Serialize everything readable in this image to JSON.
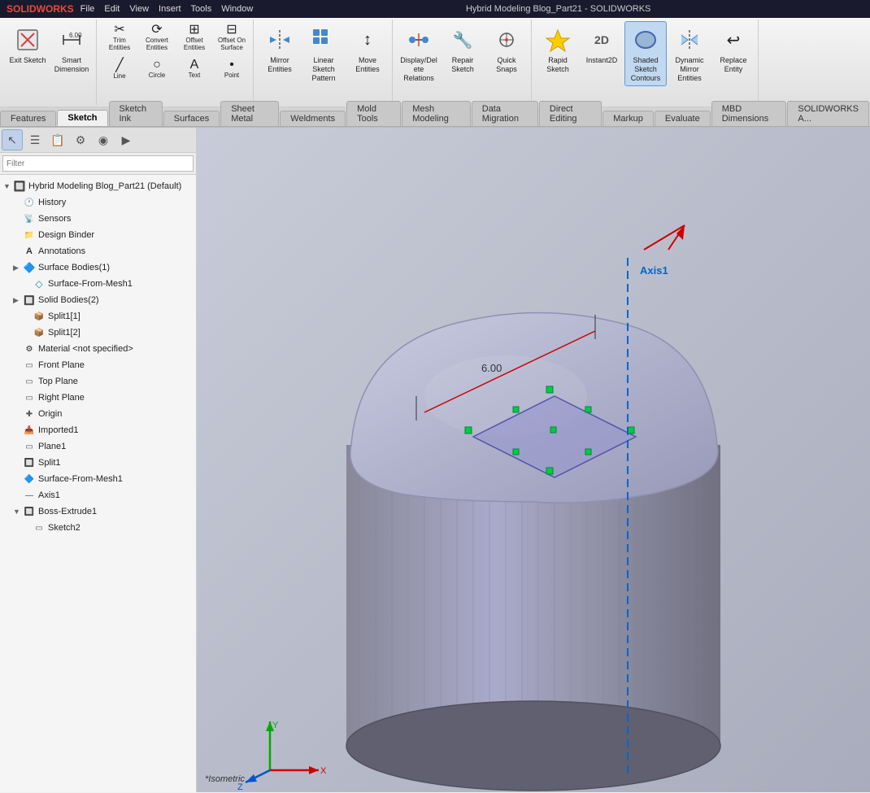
{
  "app": {
    "logo": "SOLIDWORKS",
    "title": "Hybrid Modeling Blog_Part21 - SOLIDWORKS"
  },
  "menubar": {
    "items": [
      "File",
      "Edit",
      "View",
      "Insert",
      "Tools",
      "Window"
    ]
  },
  "toolbar": {
    "groups": [
      {
        "name": "sketch-exit",
        "buttons": [
          {
            "id": "exit-sketch",
            "icon": "📐",
            "label": "Exit\nSketch",
            "active": false
          },
          {
            "id": "smart-dimension",
            "icon": "↔",
            "label": "Smart\nDimension",
            "active": false
          }
        ]
      },
      {
        "name": "trim-convert",
        "buttons": [
          {
            "id": "trim-entities",
            "icon": "✂",
            "label": "Trim\nEntities",
            "active": false
          },
          {
            "id": "convert-entities",
            "icon": "⟳",
            "label": "Convert\nEntities",
            "active": false
          },
          {
            "id": "offset-entities",
            "icon": "⊞",
            "label": "Offset\nEntities",
            "active": false
          },
          {
            "id": "offset-on-surface",
            "icon": "⊟",
            "label": "Offset\nOn\nSurface",
            "active": false
          }
        ]
      },
      {
        "name": "mirror-move",
        "buttons": [
          {
            "id": "mirror-entities",
            "icon": "⟺",
            "label": "Mirror Entities",
            "active": false
          },
          {
            "id": "linear-sketch-pattern",
            "icon": "⊞",
            "label": "Linear Sketch\nPattern",
            "active": false
          },
          {
            "id": "move-entities",
            "icon": "↕",
            "label": "Move Entities",
            "active": false
          }
        ]
      },
      {
        "name": "display-repair",
        "buttons": [
          {
            "id": "display-delete-relations",
            "icon": "🔗",
            "label": "Display/Delete\nRelations",
            "active": false
          },
          {
            "id": "repair-sketch",
            "icon": "🔧",
            "label": "Repair\nSketch",
            "active": false
          },
          {
            "id": "quick-snaps",
            "icon": "🎯",
            "label": "Quick\nSnaps",
            "active": false
          }
        ]
      },
      {
        "name": "rapid",
        "buttons": [
          {
            "id": "rapid-sketch",
            "icon": "⚡",
            "label": "Rapid\nSketch",
            "active": false
          },
          {
            "id": "instant2d",
            "icon": "2D",
            "label": "Instant2D",
            "active": false
          },
          {
            "id": "shaded-sketch-contours",
            "icon": "🎨",
            "label": "Shaded\nSketch\nContours",
            "active": true
          },
          {
            "id": "dynamic-mirror",
            "icon": "⟺",
            "label": "Dynamic\nMirror\nEntities",
            "active": false
          },
          {
            "id": "replace-entity",
            "icon": "↩",
            "label": "Replace\nEntity",
            "active": false
          }
        ]
      }
    ]
  },
  "tabs": [
    {
      "id": "features",
      "label": "Features",
      "active": false
    },
    {
      "id": "sketch",
      "label": "Sketch",
      "active": true
    },
    {
      "id": "sketch-ink",
      "label": "Sketch Ink",
      "active": false
    },
    {
      "id": "surfaces",
      "label": "Surfaces",
      "active": false
    },
    {
      "id": "sheet-metal",
      "label": "Sheet Metal",
      "active": false
    },
    {
      "id": "weldments",
      "label": "Weldments",
      "active": false
    },
    {
      "id": "mold-tools",
      "label": "Mold Tools",
      "active": false
    },
    {
      "id": "mesh-modeling",
      "label": "Mesh Modeling",
      "active": false
    },
    {
      "id": "data-migration",
      "label": "Data Migration",
      "active": false
    },
    {
      "id": "direct-editing",
      "label": "Direct Editing",
      "active": false
    },
    {
      "id": "markup",
      "label": "Markup",
      "active": false
    },
    {
      "id": "evaluate",
      "label": "Evaluate",
      "active": false
    },
    {
      "id": "mbd-dimensions",
      "label": "MBD Dimensions",
      "active": false
    },
    {
      "id": "solidworks-a",
      "label": "SOLIDWORKS A...",
      "active": false
    }
  ],
  "panel": {
    "icons": [
      {
        "id": "cursor",
        "icon": "↖",
        "active": true
      },
      {
        "id": "list",
        "icon": "☰",
        "active": false
      },
      {
        "id": "properties",
        "icon": "📋",
        "active": false
      },
      {
        "id": "settings",
        "icon": "⚙",
        "active": false
      },
      {
        "id": "display",
        "icon": "◉",
        "active": false
      },
      {
        "id": "expand",
        "icon": "▶",
        "active": false
      }
    ],
    "filter_placeholder": "Filter",
    "tree": {
      "root": "Hybrid Modeling Blog_Part21 (Default)",
      "items": [
        {
          "indent": 1,
          "icon": "🕐",
          "label": "History",
          "arrow": ""
        },
        {
          "indent": 1,
          "icon": "📡",
          "label": "Sensors",
          "arrow": ""
        },
        {
          "indent": 1,
          "icon": "📁",
          "label": "Design Binder",
          "arrow": ""
        },
        {
          "indent": 1,
          "icon": "A",
          "label": "Annotations",
          "arrow": ""
        },
        {
          "indent": 1,
          "icon": "🔷",
          "label": "Surface Bodies(1)",
          "arrow": "▶"
        },
        {
          "indent": 2,
          "icon": "◇",
          "label": "Surface-From-Mesh1",
          "arrow": ""
        },
        {
          "indent": 1,
          "icon": "🔲",
          "label": "Solid Bodies(2)",
          "arrow": "▶"
        },
        {
          "indent": 2,
          "icon": "📦",
          "label": "Split1[1]",
          "arrow": ""
        },
        {
          "indent": 2,
          "icon": "📦",
          "label": "Split1[2]",
          "arrow": ""
        },
        {
          "indent": 1,
          "icon": "⚙",
          "label": "Material <not specified>",
          "arrow": ""
        },
        {
          "indent": 1,
          "icon": "▭",
          "label": "Front Plane",
          "arrow": ""
        },
        {
          "indent": 1,
          "icon": "▭",
          "label": "Top Plane",
          "arrow": ""
        },
        {
          "indent": 1,
          "icon": "▭",
          "label": "Right Plane",
          "arrow": ""
        },
        {
          "indent": 1,
          "icon": "✚",
          "label": "Origin",
          "arrow": ""
        },
        {
          "indent": 1,
          "icon": "📥",
          "label": "Imported1",
          "arrow": ""
        },
        {
          "indent": 1,
          "icon": "▭",
          "label": "Plane1",
          "arrow": ""
        },
        {
          "indent": 1,
          "icon": "🔲",
          "label": "Split1",
          "arrow": ""
        },
        {
          "indent": 1,
          "icon": "🔷",
          "label": "Surface-From-Mesh1",
          "arrow": ""
        },
        {
          "indent": 1,
          "icon": "—",
          "label": "Axis1",
          "arrow": ""
        },
        {
          "indent": 1,
          "icon": "🔲",
          "label": "Boss-Extrude1",
          "arrow": "▼"
        },
        {
          "indent": 2,
          "icon": "▭",
          "label": "Sketch2",
          "arrow": ""
        }
      ]
    }
  },
  "viewport": {
    "label": "*Isometric",
    "axis_label": "Axis1",
    "dimension_label": "6.00",
    "bg_color": "#b0b4c4"
  }
}
